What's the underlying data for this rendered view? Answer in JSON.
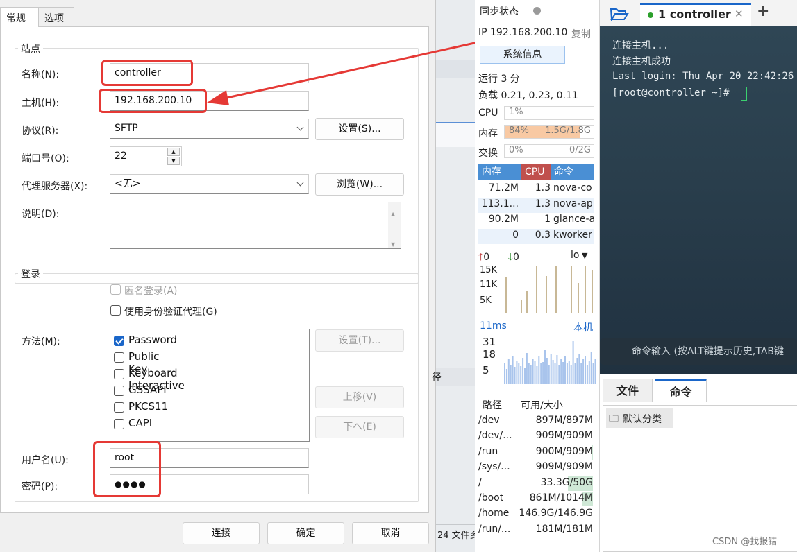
{
  "dialog": {
    "tabs": [
      {
        "label": "常规",
        "active": true
      },
      {
        "label": "选项",
        "active": false
      }
    ],
    "site_group": "站点",
    "fields": {
      "name": {
        "label": "名称(N):",
        "value": "controller"
      },
      "host": {
        "label": "主机(H):",
        "value": "192.168.200.10"
      },
      "protocol": {
        "label": "协议(R):",
        "value": "SFTP",
        "settings_button": "设置(S)..."
      },
      "port": {
        "label": "端口号(O):",
        "value": "22"
      },
      "proxy": {
        "label": "代理服务器(X):",
        "value": "<无>",
        "browse_button": "浏览(W)..."
      },
      "description": {
        "label": "说明(D):",
        "value": ""
      }
    },
    "login_group": "登录",
    "anonymous": {
      "label": "匿名登录(A)",
      "checked": false,
      "disabled": true
    },
    "agent": {
      "label": "使用身份验证代理(G)",
      "checked": false
    },
    "method": {
      "label": "方法(M):",
      "items": [
        {
          "label": "Password",
          "checked": true
        },
        {
          "label": "Public Key",
          "checked": false
        },
        {
          "label": "Keyboard Interactive",
          "checked": false
        },
        {
          "label": "GSSAPI",
          "checked": false
        },
        {
          "label": "PKCS11",
          "checked": false
        },
        {
          "label": "CAPI",
          "checked": false
        }
      ],
      "settings_button": "设置(T)...",
      "up_button": "上移(V)",
      "down_button": "下へ(E)"
    },
    "username": {
      "label": "用户名(U):",
      "value": "root"
    },
    "password": {
      "label": "密码(P):",
      "value": "●●●●"
    },
    "buttons": {
      "connect": "连接",
      "ok": "确定",
      "cancel": "取消"
    }
  },
  "background_fragments": {
    "col": "径",
    "status": "24  文件乡"
  },
  "monitor": {
    "sync_status": "同步状态",
    "ip": "IP 192.168.200.10",
    "copy": "复制",
    "sysinfo_button": "系统信息",
    "uptime": "运行 3 分",
    "load": "负载 0.21, 0.23, 0.11",
    "cpu": {
      "label": "CPU",
      "text": "1%",
      "fraction": 0.01
    },
    "mem": {
      "label": "内存",
      "text": "84%",
      "size": "1.5G/1.8G",
      "fraction": 0.84
    },
    "swap": {
      "label": "交换",
      "text": "0%",
      "size": "0/2G",
      "fraction": 0.0
    },
    "proc_headers": [
      "内存",
      "CPU",
      "命令"
    ],
    "processes": [
      {
        "mem": "71.2M",
        "cpu": "1.3",
        "cmd": "nova-co"
      },
      {
        "mem": "113.1...",
        "cpu": "1.3",
        "cmd": "nova-ap"
      },
      {
        "mem": "90.2M",
        "cpu": "1",
        "cmd": "glance-a"
      },
      {
        "mem": "0",
        "cpu": "0.3",
        "cmd": "kworker"
      }
    ],
    "net": {
      "up": "0",
      "down": "0",
      "iface": "lo",
      "ticks": [
        "15K",
        "11K",
        "5K"
      ]
    },
    "latency": {
      "value": "11ms",
      "host": "本机",
      "ticks": [
        "31",
        "18",
        "5"
      ]
    },
    "disk_headers": [
      "路径",
      "可用/大小"
    ],
    "disks": [
      {
        "path": "/dev",
        "size": "897M/897M",
        "used_frac": 0.0
      },
      {
        "path": "/dev/...",
        "size": "909M/909M",
        "used_frac": 0.0
      },
      {
        "path": "/run",
        "size": "900M/909M",
        "used_frac": 0.01
      },
      {
        "path": "/sys/...",
        "size": "909M/909M",
        "used_frac": 0.0
      },
      {
        "path": "/",
        "size": "33.3G/50G",
        "used_frac": 0.33
      },
      {
        "path": "/boot",
        "size": "861M/1014M",
        "used_frac": 0.15
      },
      {
        "path": "/home",
        "size": "146.9G/146.9G",
        "used_frac": 0.0
      },
      {
        "path": "/run/...",
        "size": "181M/181M",
        "used_frac": 0.0
      }
    ]
  },
  "terminal": {
    "tab_label": "1 controller",
    "lines": [
      "连接主机...",
      "连接主机成功",
      "Last login: Thu Apr 20 22:42:26",
      "[root@controller ~]# "
    ],
    "cmd_placeholder": "命令输入 (按ALT键提示历史,TAB键"
  },
  "bottom": {
    "tabs": [
      {
        "label": "文件",
        "active": false
      },
      {
        "label": "命令",
        "active": true
      }
    ],
    "folder": "默认分类"
  },
  "watermark": "CSDN @找报错",
  "colors": {
    "accent": "#1a66c9",
    "annotation_red": "#e53935",
    "mem_fill": "#f8c9a3",
    "cpu_header": "#c0504d",
    "proc_header": "#4a8fd4",
    "chart_bar": "#c8b896",
    "latency_bar": "#a9c4ec"
  }
}
